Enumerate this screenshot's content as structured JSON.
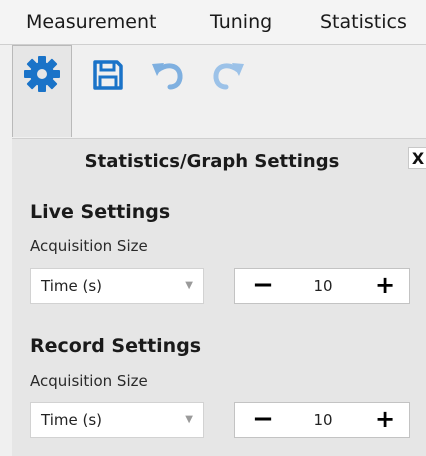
{
  "menu": {
    "items": [
      {
        "label": "Measurement"
      },
      {
        "label": "Tuning"
      },
      {
        "label": "Statistics"
      }
    ]
  },
  "toolbar": {
    "buttons": [
      {
        "icon": "gear-icon",
        "color": "#1a73c8",
        "active": true
      },
      {
        "icon": "save-icon",
        "color": "#1a73c8"
      },
      {
        "icon": "undo-icon",
        "color": "#7fb0e0"
      },
      {
        "icon": "redo-icon",
        "color": "#9cc2e8"
      }
    ]
  },
  "panel": {
    "title": "Statistics/Graph Settings",
    "close_label": "X",
    "live": {
      "heading": "Live Settings",
      "field_label": "Acquisition Size",
      "select_value": "Time (s)",
      "stepper": {
        "minus": "−",
        "value": "10",
        "plus": "+"
      }
    },
    "record": {
      "heading": "Record Settings",
      "field_label": "Acquisition Size",
      "select_value": "Time (s)",
      "stepper": {
        "minus": "−",
        "value": "10",
        "plus": "+"
      }
    }
  }
}
